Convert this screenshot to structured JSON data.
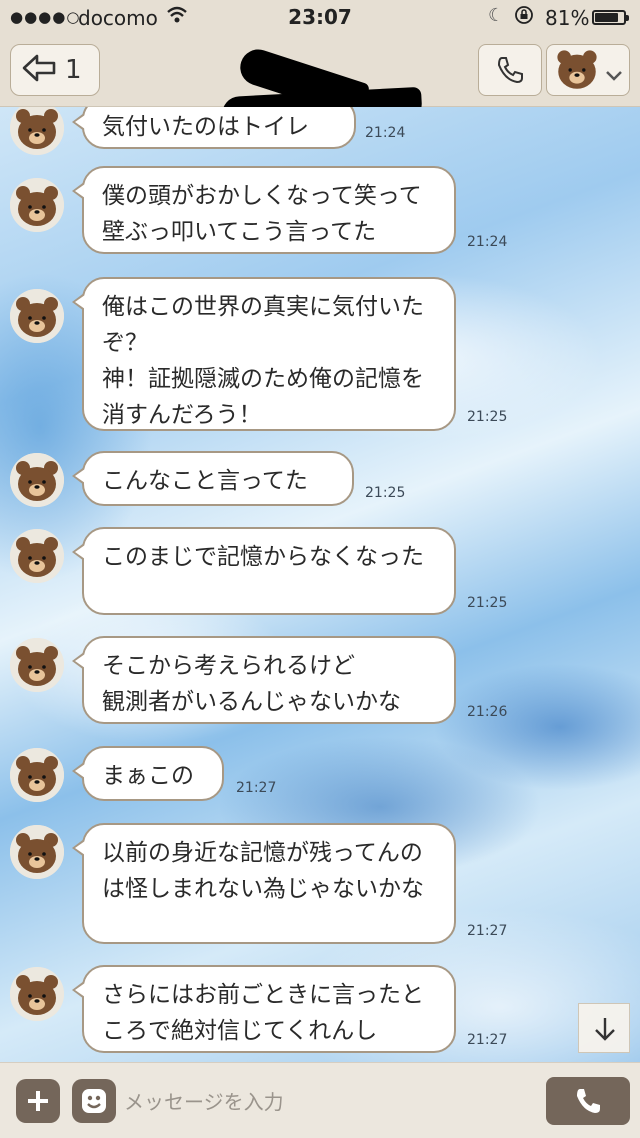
{
  "status_bar": {
    "signal": "●●●●○",
    "carrier": "docomo",
    "time": "23:07",
    "battery_percent": "81%",
    "battery_level": 0.81
  },
  "header": {
    "back_count": "1",
    "chat_title": ""
  },
  "messages": [
    {
      "text": "気付いたのはトイレ",
      "time": "21:24"
    },
    {
      "text": "僕の頭がおかしくなって笑って壁ぶっ叩いてこう言ってた",
      "time": "21:24"
    },
    {
      "text": "俺はこの世界の真実に気付いたぞ？\n神！証拠隠滅のため俺の記憶を消すんだろう！",
      "time": "21:25"
    },
    {
      "text": "こんなこと言ってた",
      "time": "21:25"
    },
    {
      "text": "このまじで記憶からなくなった",
      "time": "21:25"
    },
    {
      "text": "そこから考えられるけど\n観測者がいるんじゃないかな",
      "time": "21:26"
    },
    {
      "text": "まぁこの",
      "time": "21:27"
    },
    {
      "text": "以前の身近な記憶が残ってんのは怪しまれない為じゃないかな",
      "time": "21:27"
    },
    {
      "text": "さらにはお前ごときに言ったところで絶対信じてくれんし",
      "time": "21:27"
    }
  ],
  "input": {
    "placeholder": "メッセージを入力"
  },
  "colors": {
    "header_bg": "#e6dfd3",
    "bubble_border": "#a79884",
    "button_brown": "#74665a",
    "bear_brown": "#7a5030"
  },
  "icons": {
    "avatar": "brown-bear-icon",
    "call": "phone-icon",
    "scroll": "arrow-down-icon",
    "plus": "plus-icon",
    "sticker": "smiley-icon",
    "voice": "phone-icon"
  }
}
